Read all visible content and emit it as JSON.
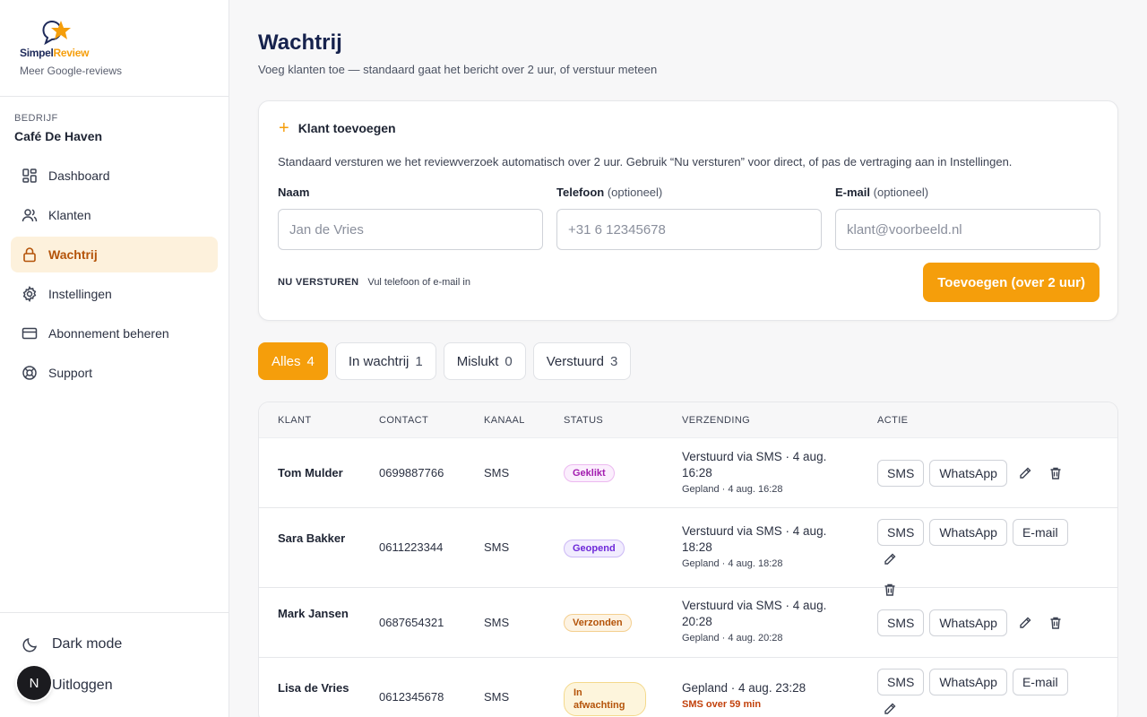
{
  "brand": {
    "name_part1": "Simpel",
    "name_part2": "Review",
    "tagline": "Meer Google-reviews"
  },
  "company": {
    "label": "BEDRIJF",
    "name": "Café De Haven"
  },
  "nav": [
    {
      "label": "Dashboard",
      "icon": "dashboard-icon"
    },
    {
      "label": "Klanten",
      "icon": "users-icon"
    },
    {
      "label": "Wachtrij",
      "icon": "lock-icon",
      "active": true
    },
    {
      "label": "Instellingen",
      "icon": "gear-icon"
    },
    {
      "label": "Abonnement beheren",
      "icon": "credit-card-icon"
    },
    {
      "label": "Support",
      "icon": "lifebuoy-icon"
    }
  ],
  "bottom": {
    "dark_mode": "Dark mode",
    "logout": "Uitloggen",
    "avatar_initial": "N"
  },
  "page": {
    "title": "Wachtrij",
    "subtitle": "Voeg klanten toe — standaard gaat het bericht over 2 uur, of verstuur meteen"
  },
  "form": {
    "header": "Klant toevoegen",
    "description": "Standaard versturen we het reviewverzoek automatisch over 2 uur. Gebruik “Nu versturen” voor direct, of pas de vertraging aan in Instellingen.",
    "name_label": "Naam",
    "name_placeholder": "Jan de Vries",
    "phone_label": "Telefoon",
    "phone_optional": "(optioneel)",
    "phone_placeholder": "+31 6 12345678",
    "email_label": "E-mail",
    "email_optional": "(optioneel)",
    "email_placeholder": "klant@voorbeeld.nl",
    "now_label": "NU VERSTUREN",
    "now_hint": "Vul telefoon of e-mail in",
    "submit": "Toevoegen (over 2 uur)"
  },
  "tabs": [
    {
      "label": "Alles",
      "count": "4",
      "active": true
    },
    {
      "label": "In wachtrij",
      "count": "1"
    },
    {
      "label": "Mislukt",
      "count": "0"
    },
    {
      "label": "Verstuurd",
      "count": "3"
    }
  ],
  "table": {
    "headers": {
      "klant": "KLANT",
      "contact": "CONTACT",
      "kanaal": "KANAAL",
      "status": "STATUS",
      "verzending": "VERZENDING",
      "actie": "ACTIE"
    },
    "rows": [
      {
        "name": "Tom Mulder",
        "contact": "0699887766",
        "kanaal": "SMS",
        "status": "Geklikt",
        "verz_main": "Verstuurd via SMS · 4 aug. 16:28",
        "verz_sub": "Gepland · 4 aug. 16:28"
      },
      {
        "name": "Sara Bakker",
        "contact": "0611223344",
        "kanaal": "SMS",
        "status": "Geopend",
        "verz_main": "Verstuurd via SMS · 4 aug. 18:28",
        "verz_sub": "Gepland · 4 aug. 18:28"
      },
      {
        "name": "Mark Jansen",
        "contact": "0687654321",
        "kanaal": "SMS",
        "status": "Verzonden",
        "verz_main": "Verstuurd via SMS · 4 aug. 20:28",
        "verz_sub": "Gepland · 4 aug. 20:28"
      },
      {
        "name": "Lisa de Vries",
        "contact": "0612345678",
        "kanaal": "SMS",
        "status": "In afwachting",
        "verz_main": "Gepland · 4 aug. 23:28",
        "verz_sub": "SMS over 59 min"
      }
    ],
    "action_labels": {
      "sms": "SMS",
      "whatsapp": "WhatsApp",
      "email": "E-mail"
    }
  },
  "colors": {
    "accent": "#f59e0b",
    "navy": "#16224d"
  }
}
